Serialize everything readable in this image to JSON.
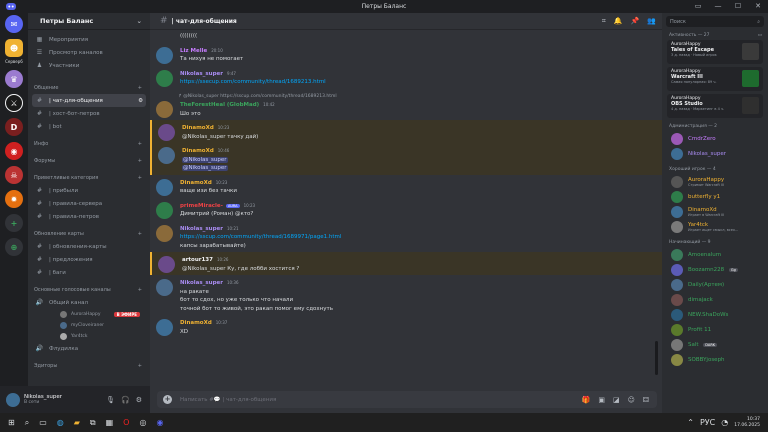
{
  "window": {
    "title": "Петры Баланс"
  },
  "server": {
    "name": "Петры Баланс",
    "folder_label": "Сервер6",
    "top_items": [
      {
        "icon": "calendar-icon",
        "label": "Мероприятия"
      },
      {
        "icon": "browse-icon",
        "label": "Просмотр каналов"
      },
      {
        "icon": "members-icon",
        "label": "Участники"
      }
    ]
  },
  "categories": [
    {
      "name": "Общение",
      "channels": [
        {
          "icon": "#",
          "label": "| чат-для-общения",
          "active": true
        },
        {
          "icon": "#",
          "label": "| хост-бот-петров"
        },
        {
          "icon": "#",
          "label": "| bot"
        }
      ]
    },
    {
      "name": "Инфо",
      "channels": []
    },
    {
      "name": "Форумы",
      "channels": []
    },
    {
      "name": "Приветливые категория",
      "channels": [
        {
          "icon": "#",
          "label": "| прибыли"
        },
        {
          "icon": "#",
          "label": "| правила-сервера"
        },
        {
          "icon": "#",
          "label": "| правила-петров"
        }
      ]
    },
    {
      "name": "Обновление карты",
      "channels": [
        {
          "icon": "#",
          "label": "| обновления-карты"
        },
        {
          "icon": "#",
          "label": "| предложения"
        },
        {
          "icon": "#",
          "label": "| баги"
        }
      ]
    },
    {
      "name": "Основные голосовые каналы",
      "channels": [
        {
          "icon": "speaker",
          "label": "Общий канал"
        }
      ]
    }
  ],
  "voice_users": [
    {
      "name": "AuroraHappy",
      "live": "В ЭФИРЕ"
    },
    {
      "name": "myCloveiraner"
    },
    {
      "name": "Yar4tck"
    }
  ],
  "extra_channels": [
    {
      "label": "Флудилка"
    }
  ],
  "extra_category": "Эдиторы",
  "user": {
    "name": "Nikolas_super",
    "status": "В сети"
  },
  "chat": {
    "channel": "| чат-для-общения",
    "placeholder": "Написать #💬 | чат-для-общения",
    "messages": [
      {
        "author": "",
        "time": "",
        "text": "((((((((",
        "color": "#dbdee1"
      },
      {
        "author": "Liz Melle",
        "time": "20:10",
        "text": "Та нихуя не помогает",
        "color": "#c77dff"
      },
      {
        "author": "Nikolas_super",
        "time": "9:47",
        "text": "https://ssecup.com/community/thread/1689213.html",
        "color": "#a98cf2",
        "link": true
      },
      {
        "author": "TheForestHeal (GlobMad)",
        "time": "10:42",
        "reply": "@Nikolas_super https://sscup.com/community/thread/1689213.html",
        "text": "Шо это",
        "color": "#3ba55d"
      },
      {
        "author": "DinamoXd",
        "time": "10:23",
        "text": "@Nikolas_super тачку дай)",
        "color": "#f0b232",
        "hl": true
      },
      {
        "author": "DinamoXd",
        "time": "10:46",
        "text": "@Nikolas_super",
        "text2": "@Nikolas_super",
        "color": "#f0b232",
        "hl": true
      },
      {
        "author": "DinamoXd",
        "time": "10:23",
        "text": "ваще изи без тачки",
        "color": "#f0b232"
      },
      {
        "author": "primeMiracle-",
        "badge": "AURA",
        "time": "10:23",
        "text": "Димитрий (Роман) @кто?",
        "color": "#ed4245"
      },
      {
        "author": "Nikolas_super",
        "time": "10:21",
        "text": "https://sscup.com/community/thread/1689971/page1.html",
        "text2": "капсы зарабатывайте)",
        "color": "#a98cf2",
        "link": true
      },
      {
        "author": "artour137",
        "time": "10:26",
        "text": "@Nikolas_super Ку, где лобби хостится ?",
        "color": "#f2f3f5",
        "hl": true
      },
      {
        "author": "Nikolas_super",
        "time": "10:36",
        "text": "на ракате",
        "text2": "бот то сдох, но уже только что начали",
        "text3": "точной бот то живой, это ракап помог ему сдохнуть",
        "color": "#a98cf2"
      },
      {
        "author": "DinamoXd",
        "time": "10:37",
        "text": "XD",
        "color": "#f0b232"
      }
    ]
  },
  "members": {
    "search_placeholder": "Поиск",
    "activity_title": "Активность — 27",
    "activities": [
      {
        "user": "AuroraHappy",
        "game": "Tales of Escape",
        "status": "3 д. назад · Новый игрок",
        "color": "#3a3a3a"
      },
      {
        "user": "AuroraHappy",
        "game": "Warcraft III",
        "status": "Самая популярная: 89 ч.",
        "color": "#1e6b2e"
      },
      {
        "user": "AuroraHappy",
        "game": "OBS Studio",
        "status": "4 д. назад · Маркетинг в 4 ч.",
        "color": "#2f2f2f"
      }
    ],
    "groups": [
      {
        "title": "Администрация — 2",
        "members": [
          {
            "name": "CmdrZero",
            "color": "#c77dff",
            "av": "#9b59b6"
          },
          {
            "name": "Nikolas_super",
            "color": "#a98cf2",
            "av": "#3d6d94"
          }
        ]
      },
      {
        "title": "Хороший игрок — 4",
        "members": [
          {
            "name": "AuroraHappy",
            "sub": "Стримит Warcraft III",
            "color": "#f0b232",
            "av": "#555"
          },
          {
            "name": "butterfly y1",
            "color": "#f0b232",
            "av": "#2e7d4a"
          },
          {
            "name": "DinamoXd",
            "sub": "Играет в Warcraft III",
            "color": "#f0b232",
            "av": "#3d6d94"
          },
          {
            "name": "Yar4tck",
            "sub": "Играет ищет смысл, всех...",
            "color": "#f0b232",
            "av": "#7a7a7a"
          }
        ]
      },
      {
        "title": "Начинающий — 9",
        "members": [
          {
            "name": "Amoenalum",
            "color": "#3ba55d",
            "av": "#3a7a5a"
          },
          {
            "name": "Boozamn228",
            "color": "#3ba55d",
            "av": "#5b5bb5",
            "tag": "Gg"
          },
          {
            "name": "Daily(Артем)",
            "color": "#3ba55d",
            "av": "#4a6a8a"
          },
          {
            "name": "dimajack",
            "color": "#3ba55d",
            "av": "#6a4a4a"
          },
          {
            "name": "NEW.ShaDoWs",
            "color": "#3ba55d",
            "av": "#2b5a7a"
          },
          {
            "name": "Profit 11",
            "color": "#3ba55d",
            "av": "#5a7a2b"
          },
          {
            "name": "Salt",
            "color": "#3ba55d",
            "av": "#777",
            "tag": "DARK"
          },
          {
            "name": "SOBBYjoseph",
            "color": "#3ba55d",
            "av": "#884"
          }
        ]
      }
    ]
  },
  "taskbar": {
    "lang": "РУС",
    "time": "10:37",
    "date": "17.06.2025"
  },
  "colors": {
    "accent": "#5865f2",
    "bg": "#313338",
    "sidebar": "#2b2d31",
    "dark": "#1e1f22"
  }
}
